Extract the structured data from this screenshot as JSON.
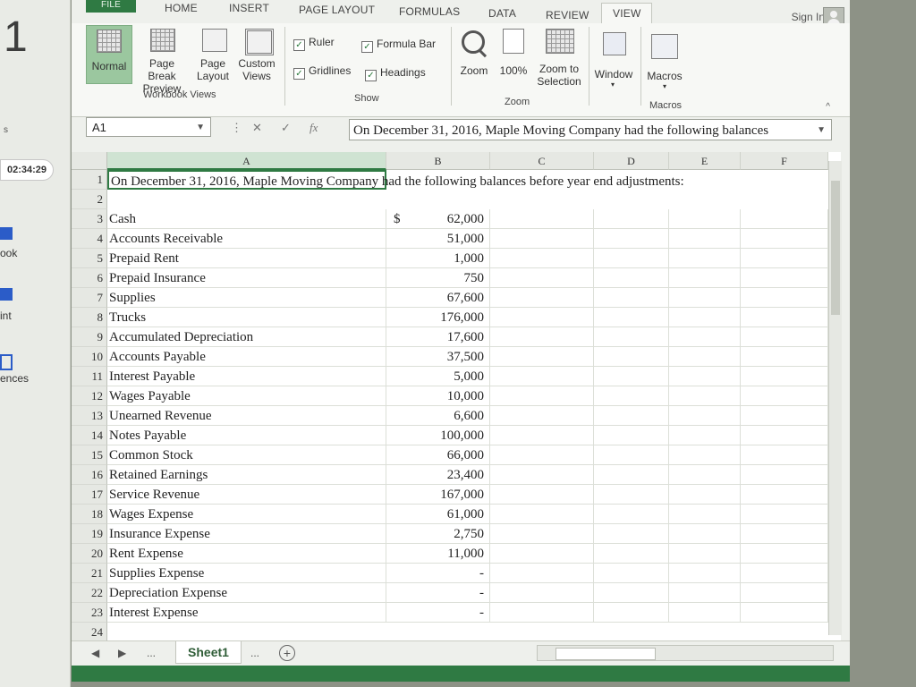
{
  "outside": {
    "big_number": "1",
    "side_s": "s",
    "timer": "02:34:29",
    "items": [
      "ook",
      "int",
      "ences"
    ]
  },
  "tabs": {
    "file": "FILE",
    "home": "HOME",
    "insert": "INSERT",
    "page_layout": "PAGE LAYOUT",
    "formulas": "FORMULAS",
    "data": "DATA",
    "review": "REVIEW",
    "view": "VIEW"
  },
  "signin": "Sign In",
  "ribbon": {
    "normal": "Normal",
    "page_break_preview": "Page Break Preview",
    "page_layout": "Page Layout",
    "custom_views": "Custom Views",
    "workbook_views_label": "Workbook Views",
    "ruler": "Ruler",
    "formula_bar": "Formula Bar",
    "gridlines": "Gridlines",
    "headings": "Headings",
    "show_label": "Show",
    "zoom": "Zoom",
    "zoom_100": "100%",
    "zoom_to_selection": "Zoom to Selection",
    "zoom_label": "Zoom",
    "window": "Window",
    "macros": "Macros",
    "macros_label": "Macros"
  },
  "formula_bar": {
    "name_box": "A1",
    "fx": "fx",
    "content": "On December 31, 2016, Maple Moving Company had the following balances"
  },
  "columns": [
    "A",
    "B",
    "C",
    "D",
    "E",
    "F"
  ],
  "sheet": {
    "title": "On December 31, 2016, Maple Moving Company had the following balances before year end adjustments:",
    "currency_symbol": "$",
    "rows": [
      {
        "n": "3",
        "label": "Cash",
        "value": "62,000"
      },
      {
        "n": "4",
        "label": "Accounts Receivable",
        "value": "51,000"
      },
      {
        "n": "5",
        "label": "Prepaid Rent",
        "value": "1,000"
      },
      {
        "n": "6",
        "label": "Prepaid Insurance",
        "value": "750"
      },
      {
        "n": "7",
        "label": "Supplies",
        "value": "67,600"
      },
      {
        "n": "8",
        "label": "Trucks",
        "value": "176,000"
      },
      {
        "n": "9",
        "label": "Accumulated Depreciation",
        "value": "17,600"
      },
      {
        "n": "10",
        "label": "Accounts Payable",
        "value": "37,500"
      },
      {
        "n": "11",
        "label": "Interest Payable",
        "value": "5,000"
      },
      {
        "n": "12",
        "label": "Wages Payable",
        "value": "10,000"
      },
      {
        "n": "13",
        "label": "Unearned Revenue",
        "value": "6,600"
      },
      {
        "n": "14",
        "label": "Notes Payable",
        "value": "100,000"
      },
      {
        "n": "15",
        "label": "Common Stock",
        "value": "66,000"
      },
      {
        "n": "16",
        "label": "Retained Earnings",
        "value": "23,400"
      },
      {
        "n": "17",
        "label": "Service Revenue",
        "value": "167,000"
      },
      {
        "n": "18",
        "label": "Wages Expense",
        "value": "61,000"
      },
      {
        "n": "19",
        "label": "Insurance Expense",
        "value": "2,750"
      },
      {
        "n": "20",
        "label": "Rent Expense",
        "value": "11,000"
      },
      {
        "n": "21",
        "label": "Supplies Expense",
        "value": "-"
      },
      {
        "n": "22",
        "label": "Depreciation Expense",
        "value": "-"
      },
      {
        "n": "23",
        "label": "Interest Expense",
        "value": "-"
      }
    ]
  },
  "sheet_tabs": {
    "active": "Sheet1",
    "ellipsis": "..."
  }
}
